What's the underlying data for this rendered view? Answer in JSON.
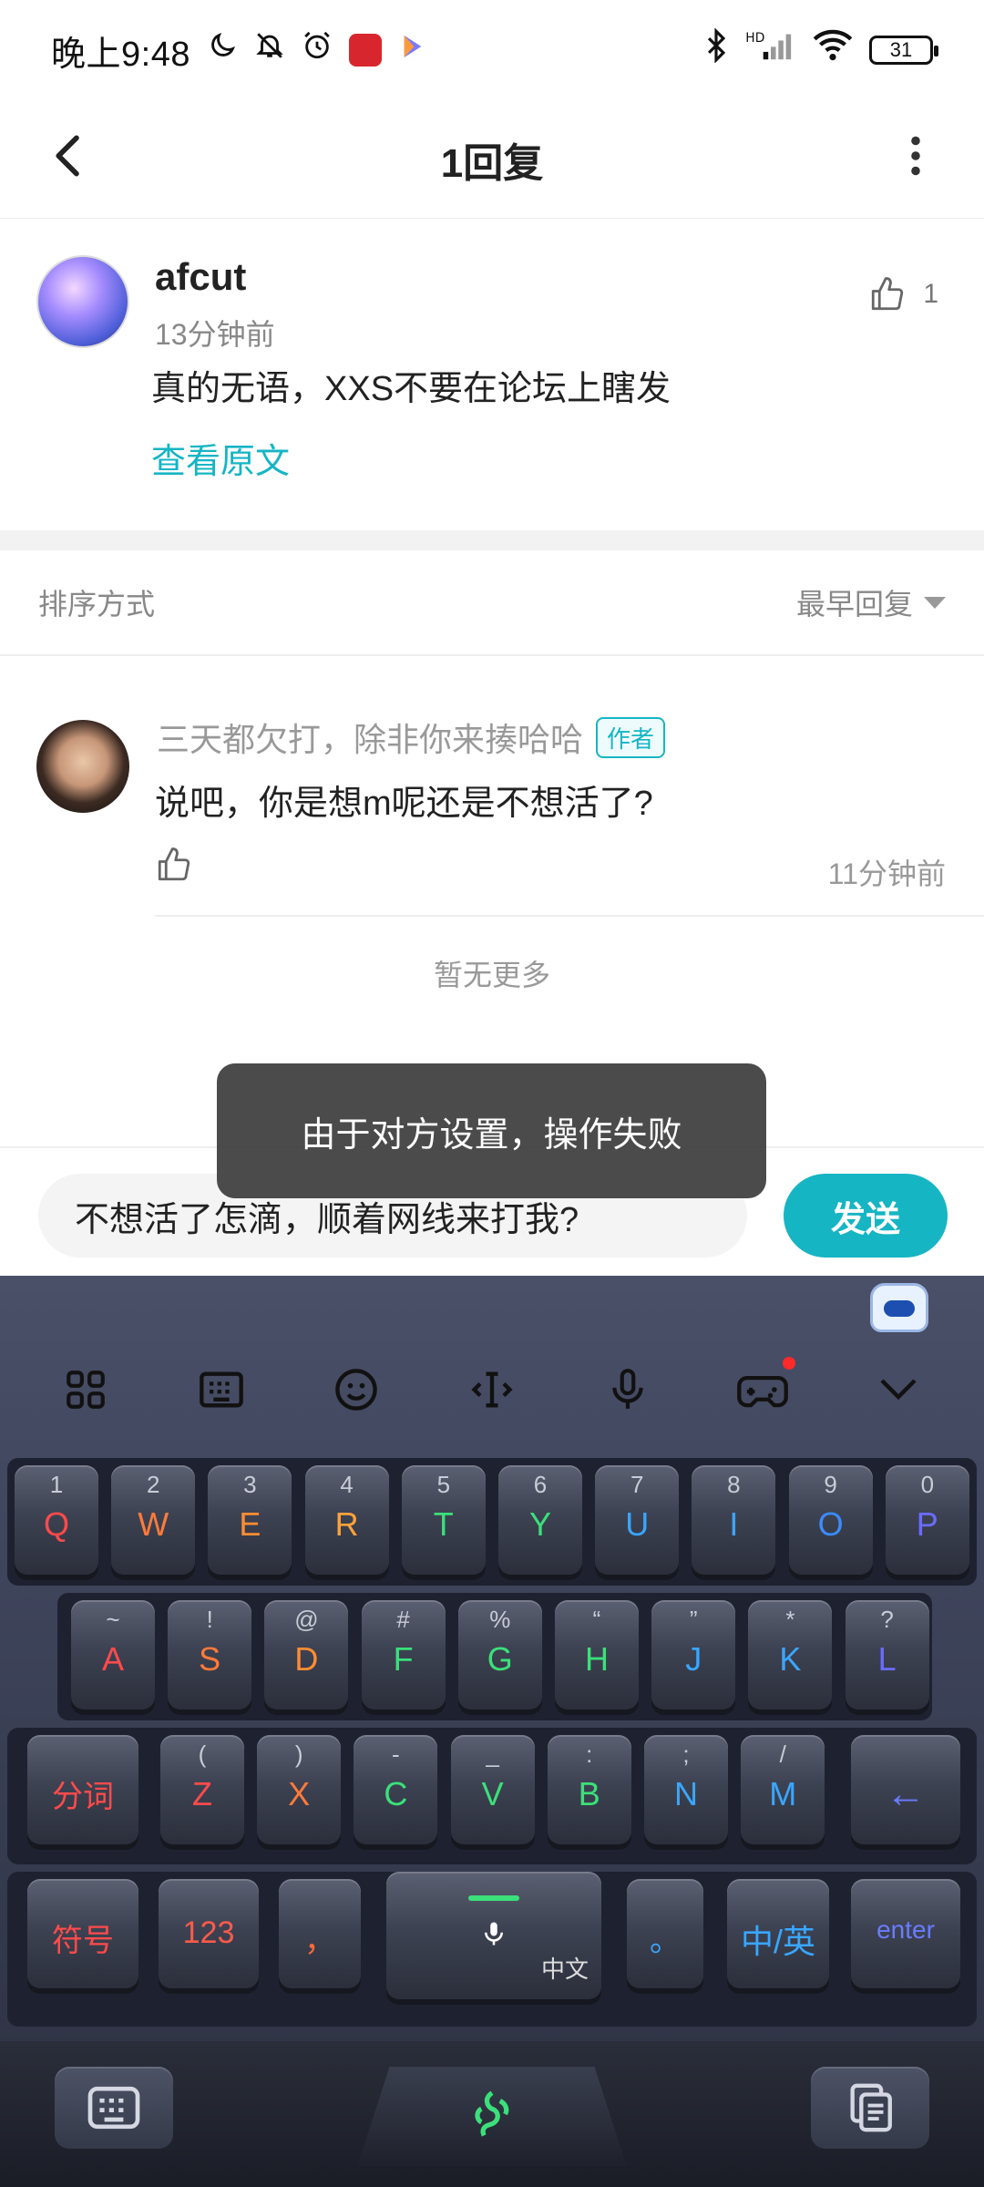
{
  "status_bar": {
    "time": "晚上9:48",
    "battery": "31",
    "network": "HD"
  },
  "header": {
    "title": "1回复"
  },
  "post": {
    "author": "afcut",
    "time": "13分钟前",
    "content": "真的无语，XXS不要在论坛上瞎发",
    "view_original": "查看原文",
    "like_count": "1"
  },
  "sort": {
    "label": "排序方式",
    "value": "最早回复"
  },
  "reply": {
    "author": "三天都欠打，除非你来揍哈哈",
    "badge": "作者",
    "content": "说吧，你是想m呢还是不想活了?",
    "time": "11分钟前"
  },
  "no_more": "暂无更多",
  "toast": "由于对方设置，操作失败",
  "input": {
    "value": "不想活了怎滴，顺着网线来打我?",
    "send_label": "发送"
  },
  "keyboard": {
    "row1": [
      {
        "sub": "1",
        "main": "Q",
        "color": "#ff4b4b"
      },
      {
        "sub": "2",
        "main": "W",
        "color": "#ff7a3a"
      },
      {
        "sub": "3",
        "main": "E",
        "color": "#ff8d33"
      },
      {
        "sub": "4",
        "main": "R",
        "color": "#ffa23a"
      },
      {
        "sub": "5",
        "main": "T",
        "color": "#3be07a"
      },
      {
        "sub": "6",
        "main": "Y",
        "color": "#3be07a"
      },
      {
        "sub": "7",
        "main": "U",
        "color": "#3aa6ff"
      },
      {
        "sub": "8",
        "main": "I",
        "color": "#3aa6ff"
      },
      {
        "sub": "9",
        "main": "O",
        "color": "#3a8cff"
      },
      {
        "sub": "0",
        "main": "P",
        "color": "#6a6cff"
      }
    ],
    "row2": [
      {
        "sub": "~",
        "main": "A",
        "color": "#ff4b4b"
      },
      {
        "sub": "!",
        "main": "S",
        "color": "#ff7a3a"
      },
      {
        "sub": "@",
        "main": "D",
        "color": "#ff8d33"
      },
      {
        "sub": "#",
        "main": "F",
        "color": "#3be07a"
      },
      {
        "sub": "%",
        "main": "G",
        "color": "#3be07a"
      },
      {
        "sub": "“",
        "main": "H",
        "color": "#3be07a"
      },
      {
        "sub": "”",
        "main": "J",
        "color": "#3aa6ff"
      },
      {
        "sub": "*",
        "main": "K",
        "color": "#3aa6ff"
      },
      {
        "sub": "?",
        "main": "L",
        "color": "#6a6cff"
      }
    ],
    "row3": [
      {
        "sub": "(",
        "main": "Z",
        "color": "#ff4b4b"
      },
      {
        "sub": ")",
        "main": "X",
        "color": "#ff7a3a"
      },
      {
        "sub": "-",
        "main": "C",
        "color": "#3be07a"
      },
      {
        "sub": "_",
        "main": "V",
        "color": "#3be07a"
      },
      {
        "sub": ":",
        "main": "B",
        "color": "#3be07a"
      },
      {
        "sub": ";",
        "main": "N",
        "color": "#3aa6ff"
      },
      {
        "sub": "/",
        "main": "M",
        "color": "#3aa6ff"
      }
    ],
    "fenci_label": "分词",
    "backspace_label": "←",
    "symbol_label": "符号",
    "num_label": "123",
    "comma_label": "，",
    "space_label": "中文",
    "period_label": "。",
    "lang_label": "中/英",
    "enter_label": "enter"
  }
}
